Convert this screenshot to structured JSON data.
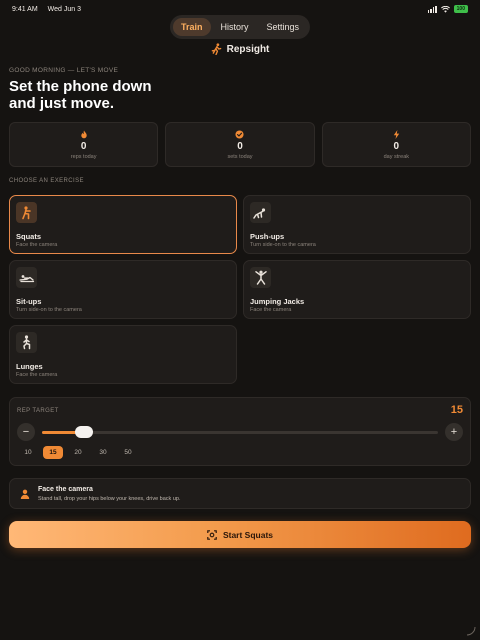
{
  "status_bar": {
    "time": "9:41 AM",
    "date": "Wed Jun 3",
    "battery": "100"
  },
  "tabs": [
    {
      "label": "Train",
      "active": true
    },
    {
      "label": "History",
      "active": false
    },
    {
      "label": "Settings",
      "active": false
    }
  ],
  "brand": {
    "name": "Repsight",
    "icon": "running-figure-icon"
  },
  "greeting": "GOOD MORNING — LET'S MOVE",
  "headline": {
    "line1": "Set the phone down",
    "line2": "and just move."
  },
  "stats": [
    {
      "icon": "flame-icon",
      "value": "0",
      "label": "reps today"
    },
    {
      "icon": "check-circle-icon",
      "value": "0",
      "label": "sets today"
    },
    {
      "icon": "bolt-icon",
      "value": "0",
      "label": "day streak"
    }
  ],
  "exercise_section_label": "CHOOSE AN EXERCISE",
  "exercises": [
    {
      "name": "Squats",
      "hint": "Face the camera",
      "selected": true,
      "icon": "squat-figure-icon"
    },
    {
      "name": "Push-ups",
      "hint": "Turn side-on to the camera",
      "selected": false,
      "icon": "pushup-figure-icon"
    },
    {
      "name": "Sit-ups",
      "hint": "Turn side-on to the camera",
      "selected": false,
      "icon": "situp-figure-icon"
    },
    {
      "name": "Jumping Jacks",
      "hint": "Face the camera",
      "selected": false,
      "icon": "jumping-jack-figure-icon"
    },
    {
      "name": "Lunges",
      "hint": "Face the camera",
      "selected": false,
      "icon": "lunge-figure-icon"
    }
  ],
  "rep_target": {
    "label": "REP TARGET",
    "value": "15",
    "min": 5,
    "max": 100,
    "decrement": "−",
    "increment": "+",
    "presets": [
      "10",
      "15",
      "20",
      "30",
      "50"
    ],
    "active_preset": "15"
  },
  "tip": {
    "title": "Face the camera",
    "text": "Stand tall, drop your hips below your knees, drive back up.",
    "icon": "person-icon"
  },
  "start_button": {
    "label": "Start Squats",
    "icon": "camera-frame-icon"
  },
  "colors": {
    "accent": "#f08a35",
    "background": "#151311",
    "card": "#1f1c1a"
  }
}
